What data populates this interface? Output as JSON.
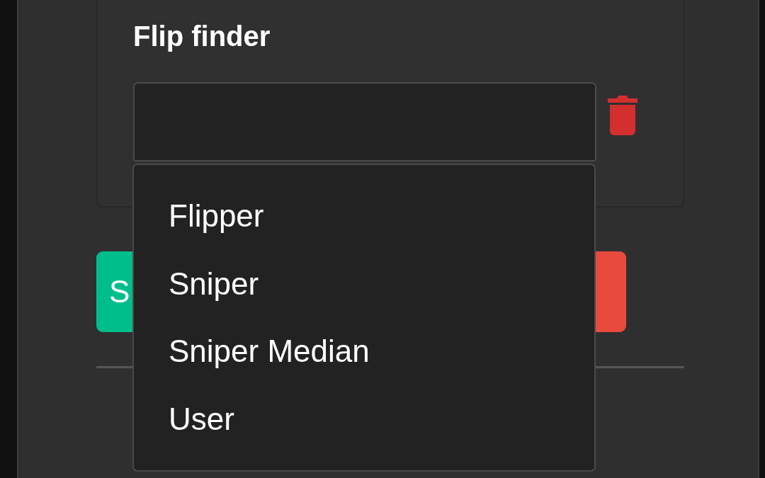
{
  "card": {
    "title": "Flip finder",
    "select": {
      "expanded": true,
      "options": [
        {
          "label": "Flipper"
        },
        {
          "label": "Sniper"
        },
        {
          "label": "Sniper Median"
        },
        {
          "label": "User"
        }
      ]
    }
  },
  "buttons": [
    {
      "kind": "confirm",
      "label": "S"
    },
    {
      "kind": "danger"
    }
  ]
}
